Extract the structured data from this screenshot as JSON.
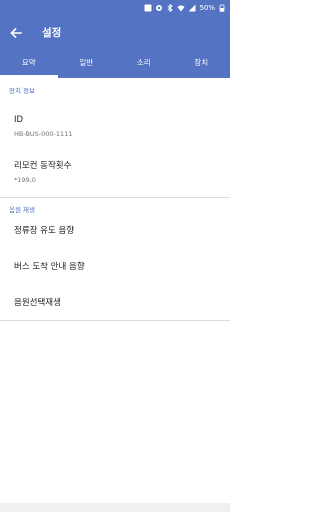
{
  "status_bar": {
    "battery_text": "50%",
    "icons": [
      "image-icon",
      "settings-icon",
      "bluetooth-icon",
      "wifi-icon",
      "signal-icon",
      "battery-icon"
    ],
    "icon_color": "#ffffff"
  },
  "app_bar": {
    "title": "설정",
    "back_icon": "arrow-left-icon",
    "color": "#5573c3"
  },
  "tabs": [
    {
      "label": "요약",
      "active": true
    },
    {
      "label": "일반",
      "active": false
    },
    {
      "label": "소리",
      "active": false
    },
    {
      "label": "장치",
      "active": false
    }
  ],
  "sections": [
    {
      "header": "장치 정보",
      "items": [
        {
          "title": "ID",
          "subtitle": "HB-BUS-000-1111"
        },
        {
          "title": "리모컨 동작횟수",
          "subtitle": "*199,0"
        }
      ]
    },
    {
      "header": "음원 재생",
      "items": [
        {
          "title": "정류장 유도 음향"
        },
        {
          "title": "버스 도착 안내 음향"
        },
        {
          "title": "음원선택재생"
        }
      ]
    }
  ],
  "colors": {
    "accent": "#5573c3",
    "section_header": "#4a6fc0",
    "divider": "#dcdcdc"
  }
}
